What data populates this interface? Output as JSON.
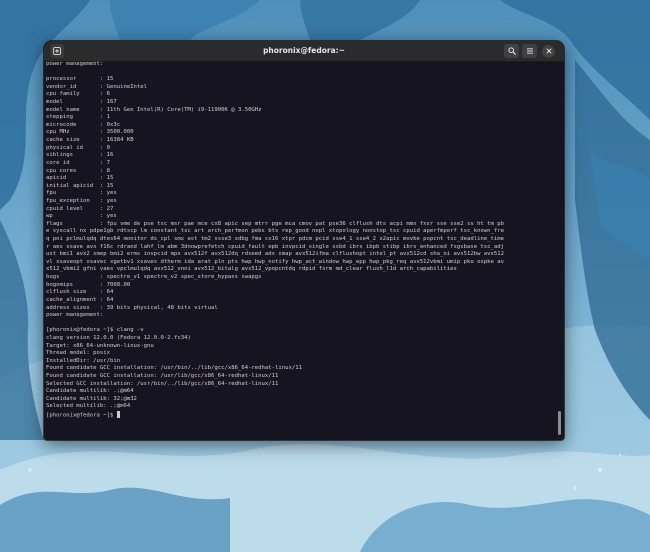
{
  "window": {
    "title": "phoronix@fedora:~"
  },
  "icons": {
    "new_tab": "new-tab-icon",
    "search": "search-icon",
    "menu": "hamburger-menu-icon",
    "close": "close-icon"
  },
  "colors": {
    "terminal_background": "#171421",
    "terminal_foreground": "#d0cfcc",
    "titlebar_background": "#2b2b2b"
  },
  "terminal": {
    "output": "power management:\n\nprocessor       : 15\nvendor_id       : GenuineIntel\ncpu family      : 6\nmodel           : 167\nmodel name      : 11th Gen Intel(R) Core(TM) i9-11900K @ 3.50GHz\nstepping        : 1\nmicrocode       : 0x3c\ncpu MHz         : 3500.000\ncache size      : 16384 KB\nphysical id     : 0\nsiblings        : 16\ncore id         : 7\ncpu cores       : 8\napicid          : 15\ninitial apicid  : 15\nfpu             : yes\nfpu_exception   : yes\ncpuid level     : 27\nwp              : yes\nflags           : fpu vme de pse tsc msr pae mce cx8 apic sep mtrr pge mca cmov pat pse36 clflush dts acpi mmx fxsr sse sse2 ss ht tm pb\ne syscall nx pdpe1gb rdtscp lm constant_tsc art arch_perfmon pebs bts rep_good nopl xtopology nonstop_tsc cpuid aperfmperf tsc_known_fre\nq pni pclmulqdq dtes64 monitor ds_cpl smx est tm2 ssse3 sdbg fma cx16 xtpr pdcm pcid sse4_1 sse4_2 x2apic movbe popcnt tsc_deadline_time\nr aes xsave avx f16c rdrand lahf_lm abm 3dnowprefetch cpuid_fault epb invpcid_single ssbd ibrs ibpb stibp ibrs_enhanced fsgsbase tsc_adj\nust bmi1 avx2 smep bmi2 erms invpcid mpx avx512f avx512dq rdseed adx smap avx512ifma clflushopt intel_pt avx512cd sha_ni avx512bw avx512\nvl xsaveopt xsavec xgetbv1 xsaves dtherm ida arat pln pts hwp hwp_notify hwp_act_window hwp_epp hwp_pkg_req avx512vbmi umip pku ospke av\nx512_vbmi2 gfni vaes vpclmulqdq avx512_vnni avx512_bitalg avx512_vpopcntdq rdpid fsrm md_clear flush_l1d arch_capabilities\nbugs            : spectre_v1 spectre_v2 spec_store_bypass swapgs\nbogomips        : 7008.00\nclflush size    : 64\ncache_alignment : 64\naddress sizes   : 39 bits physical, 48 bits virtual\npower management:\n\n[phoronix@fedora ~]$ clang -v\nclang version 12.0.0 (Fedora 12.0.0-2.fc34)\nTarget: x86_64-unknown-linux-gnu\nThread model: posix\nInstalledDir: /usr/bin\nFound candidate GCC installation: /usr/bin/../lib/gcc/x86_64-redhat-linux/11\nFound candidate GCC installation: /usr/lib/gcc/x86_64-redhat-linux/11\nSelected GCC installation: /usr/bin/../lib/gcc/x86_64-redhat-linux/11\nCandidate multilib: .;@m64\nCandidate multilib: 32;@m32\nSelected multilib: .;@m64",
    "prompt": "[phoronix@fedora ~]$ "
  }
}
